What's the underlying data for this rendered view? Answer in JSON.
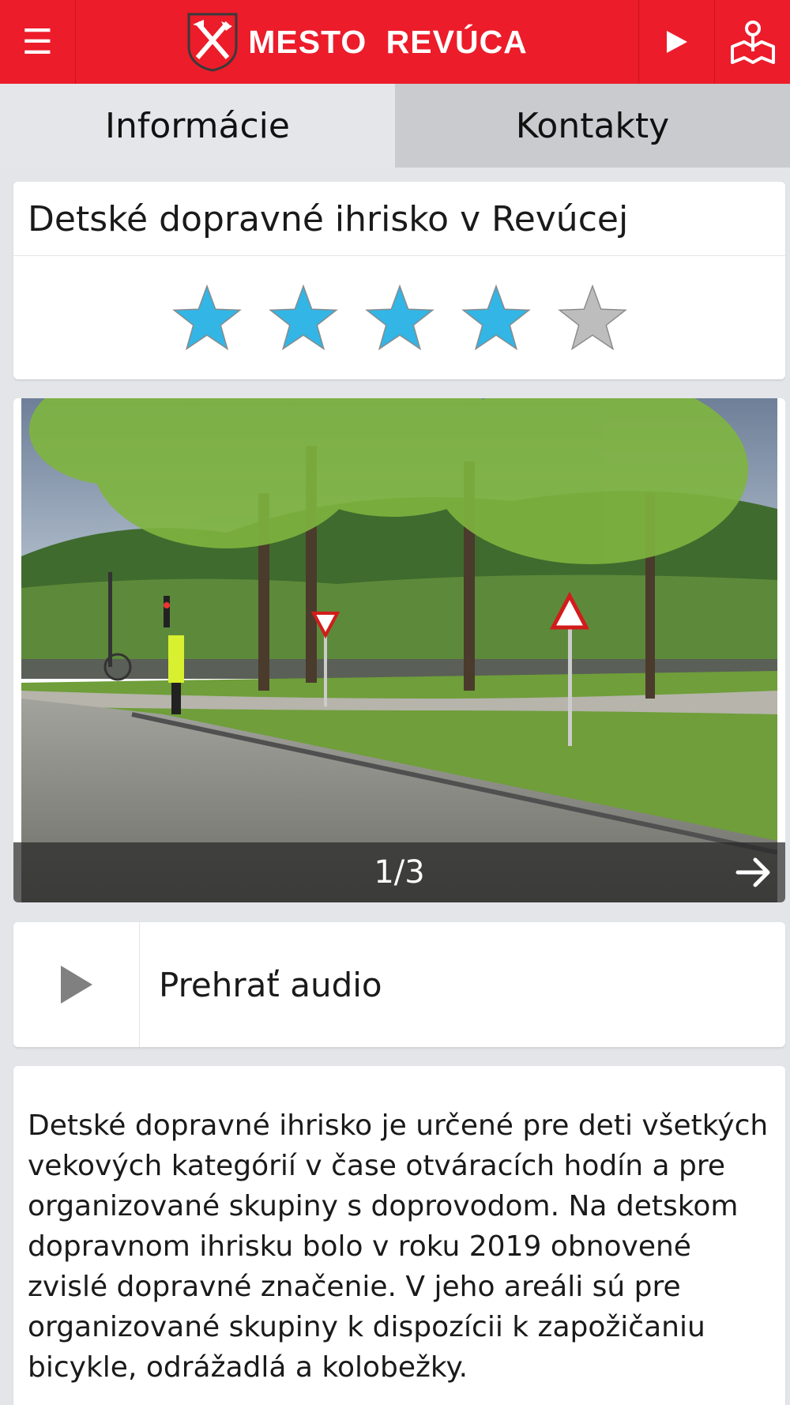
{
  "header": {
    "menu_icon": "hamburger-menu-icon",
    "logo_icon": "city-coat-of-arms-icon",
    "title": "MESTO  REVÚCA",
    "play_icon": "play-icon",
    "map_icon": "map-pin-icon",
    "brand_color": "#ec1c2a"
  },
  "tabs": [
    {
      "label": "Informácie",
      "active": true
    },
    {
      "label": "Kontakty",
      "active": false
    }
  ],
  "place": {
    "title": "Detské dopravné ihrisko v Revúcej",
    "rating": {
      "value": 4,
      "max": 5
    },
    "star_color": "#33b5e5",
    "star_empty_color": "#bdbdbd"
  },
  "gallery": {
    "counter": "1/3",
    "next_icon": "arrow-right-icon"
  },
  "audio": {
    "play_icon": "play-icon",
    "label": "Prehrať audio"
  },
  "description": {
    "text": "Detské dopravné ihrisko je určené pre deti všetkých vekových kategórií v čase otváracích hodín a pre organizované skupiny s doprovodom. Na detskom dopravnom ihrisku bolo v roku 2019 obnovené zvislé dopravné značenie. V jeho areáli sú pre organizované skupiny k dispozícii k zapožičaniu bicykle, odrážadlá a kolobežky."
  }
}
